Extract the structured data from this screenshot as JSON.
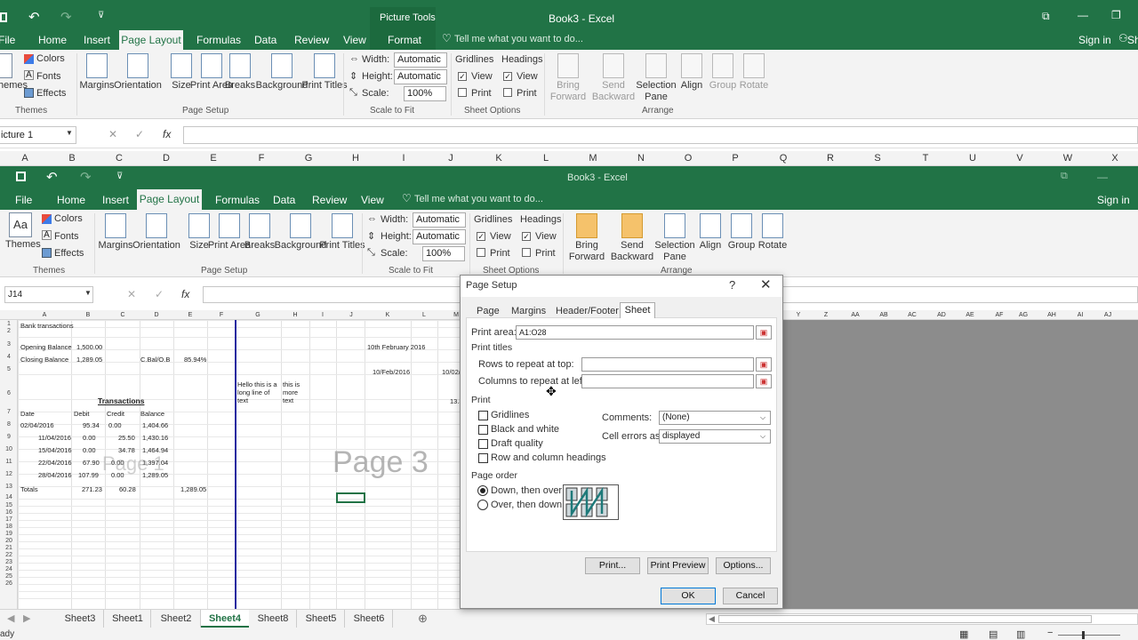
{
  "back": {
    "picture_tools": "Picture Tools",
    "title": "Book3 - Excel",
    "tabs": [
      "File",
      "Home",
      "Insert",
      "Page Layout",
      "Formulas",
      "Data",
      "Review",
      "View",
      "Format"
    ],
    "tell_me": "Tell me what you want to do...",
    "sign_in": "Sign in",
    "share": "Sh",
    "themes": {
      "label": "hemes",
      "colors": "Colors",
      "fonts": "Fonts",
      "effects": "Effects",
      "group": "Themes"
    },
    "page_setup": {
      "buttons": [
        "Margins",
        "Orientation",
        "Size",
        "Print Area",
        "Breaks",
        "Background",
        "Print Titles"
      ],
      "group": "Page Setup"
    },
    "scale": {
      "width_label": "Width:",
      "width_value": "Automatic",
      "height_label": "Height:",
      "height_value": "Automatic",
      "scale_label": "Scale:",
      "scale_value": "100%",
      "group": "Scale to Fit"
    },
    "sheet_options": {
      "gridlines": "Gridlines",
      "headings": "Headings",
      "view": "View",
      "print": "Print",
      "group": "Sheet Options"
    },
    "arrange": {
      "buttons": [
        "Bring Forward",
        "Send Backward",
        "Selection Pane",
        "Align",
        "Group",
        "Rotate"
      ],
      "group": "Arrange"
    },
    "name_box": "icture 1",
    "columns": [
      "A",
      "B",
      "C",
      "D",
      "E",
      "F",
      "G",
      "H",
      "I",
      "J",
      "K",
      "L",
      "M",
      "N",
      "O",
      "P",
      "Q",
      "R",
      "S",
      "T",
      "U",
      "V",
      "W",
      "X"
    ]
  },
  "front": {
    "title": "Book3 - Excel",
    "tabs": [
      "File",
      "Home",
      "Insert",
      "Page Layout",
      "Formulas",
      "Data",
      "Review",
      "View"
    ],
    "tell_me": "Tell me what you want to do...",
    "sign_in": "Sign in",
    "themes": {
      "label": "Themes",
      "colors": "Colors",
      "fonts": "Fonts",
      "effects": "Effects",
      "group": "Themes"
    },
    "page_setup": {
      "buttons": [
        "Margins",
        "Orientation",
        "Size",
        "Print Area",
        "Breaks",
        "Background",
        "Print Titles"
      ],
      "group": "Page Setup"
    },
    "scale": {
      "width_label": "Width:",
      "width_value": "Automatic",
      "height_label": "Height:",
      "height_value": "Automatic",
      "scale_label": "Scale:",
      "scale_value": "100%",
      "group": "Scale to Fit"
    },
    "sheet_options": {
      "gridlines": "Gridlines",
      "headings": "Headings",
      "view": "View",
      "print": "Print",
      "group": "Sheet Options"
    },
    "arrange": {
      "buttons": [
        "Bring Forward",
        "Send Backward",
        "Selection Pane",
        "Align",
        "Group",
        "Rotate"
      ],
      "group": "Arrange"
    },
    "name_box": "J14",
    "columns": [
      "A",
      "B",
      "C",
      "D",
      "E",
      "F",
      "G",
      "H",
      "I",
      "J",
      "K",
      "L",
      "M"
    ],
    "right_columns": [
      "Y",
      "Z",
      "AA",
      "AB",
      "AC",
      "AD",
      "AE",
      "AF",
      "AG",
      "AH",
      "AI",
      "AJ"
    ],
    "rows": [
      "1",
      "2",
      "3",
      "4",
      "5",
      "6",
      "7",
      "8",
      "9",
      "10",
      "11",
      "12",
      "13",
      "14",
      "15",
      "16",
      "17",
      "18",
      "19",
      "20",
      "21",
      "22",
      "23",
      "24",
      "25",
      "26"
    ],
    "cells": {
      "bank": "Bank transactions",
      "opening": "Opening Balance",
      "opening_val": "1,500.00",
      "closing": "Closing Balance",
      "closing_val": "1,289.05",
      "cbal": "C.Bal/O.B",
      "pct": "85.94%",
      "date1": "10th February 2016",
      "date2": "10/Feb/2016",
      "date3": "10/02/",
      "hello": "Hello this is a long line of text",
      "this_is": "this is more text",
      "num133": "13.3",
      "transactions": "Transactions",
      "hdr_date": "Date",
      "hdr_debit": "Debit",
      "hdr_credit": "Credit",
      "hdr_balance": "Balance",
      "r8": [
        "02/04/2016",
        "95.34",
        "0.00",
        "1,404.66"
      ],
      "r9": [
        "11/04/2016",
        "0.00",
        "25.50",
        "1,430.16"
      ],
      "r10": [
        "15/04/2016",
        "0.00",
        "34.78",
        "1,464.94"
      ],
      "r11": [
        "22/04/2016",
        "67.90",
        "0.00",
        "1,397.04"
      ],
      "r12": [
        "28/04/2016",
        "107.99",
        "0.00",
        "1,289.05"
      ],
      "totals": "Totals",
      "tot_debit": "271.23",
      "tot_credit": "60.28",
      "tot_bal": "1,289.05"
    },
    "page1": "Page 1",
    "page3": "Page 3",
    "sheet_tabs": [
      "Sheet3",
      "Sheet1",
      "Sheet2",
      "Sheet4",
      "Sheet8",
      "Sheet5",
      "Sheet6"
    ],
    "active_sheet": "Sheet4",
    "status": "ady"
  },
  "dialog": {
    "title": "Page Setup",
    "help": "?",
    "tabs": [
      "Page",
      "Margins",
      "Header/Footer",
      "Sheet"
    ],
    "active_tab": "Sheet",
    "print_area_label": "Print area:",
    "print_area_value": "A1:O28",
    "print_titles": "Print titles",
    "rows_repeat": "Rows to repeat at top:",
    "cols_repeat": "Columns to repeat at left:",
    "print_section": "Print",
    "checkboxes": [
      "Gridlines",
      "Black and white",
      "Draft quality",
      "Row and column headings"
    ],
    "comments_label": "Comments:",
    "comments_value": "(None)",
    "errors_label": "Cell errors as:",
    "errors_value": "displayed",
    "page_order": "Page order",
    "down_over": "Down, then over",
    "over_down": "Over, then down",
    "print_btn": "Print...",
    "preview_btn": "Print Preview",
    "options_btn": "Options...",
    "ok": "OK",
    "cancel": "Cancel"
  }
}
